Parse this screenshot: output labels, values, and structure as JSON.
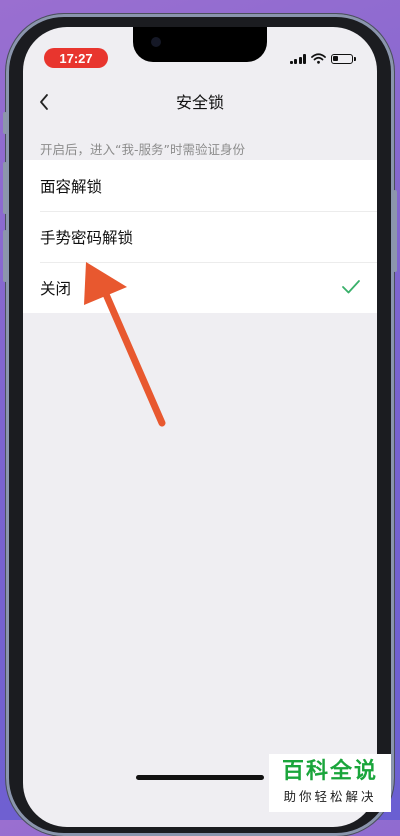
{
  "status_bar": {
    "time": "17:27"
  },
  "nav": {
    "title": "安全锁"
  },
  "hint": "开启后，进入“我-服务”时需验证身份",
  "options": [
    {
      "label": "面容解锁",
      "selected": false
    },
    {
      "label": "手势密码解锁",
      "selected": false
    },
    {
      "label": "关闭",
      "selected": true
    }
  ],
  "colors": {
    "accent_check": "#39b06a",
    "arrow": "#e8582f",
    "time_pill": "#e8352e",
    "watermark_green": "#1aa53b"
  },
  "watermark": {
    "title": "百科全说",
    "subtitle": "助你轻松解决"
  }
}
